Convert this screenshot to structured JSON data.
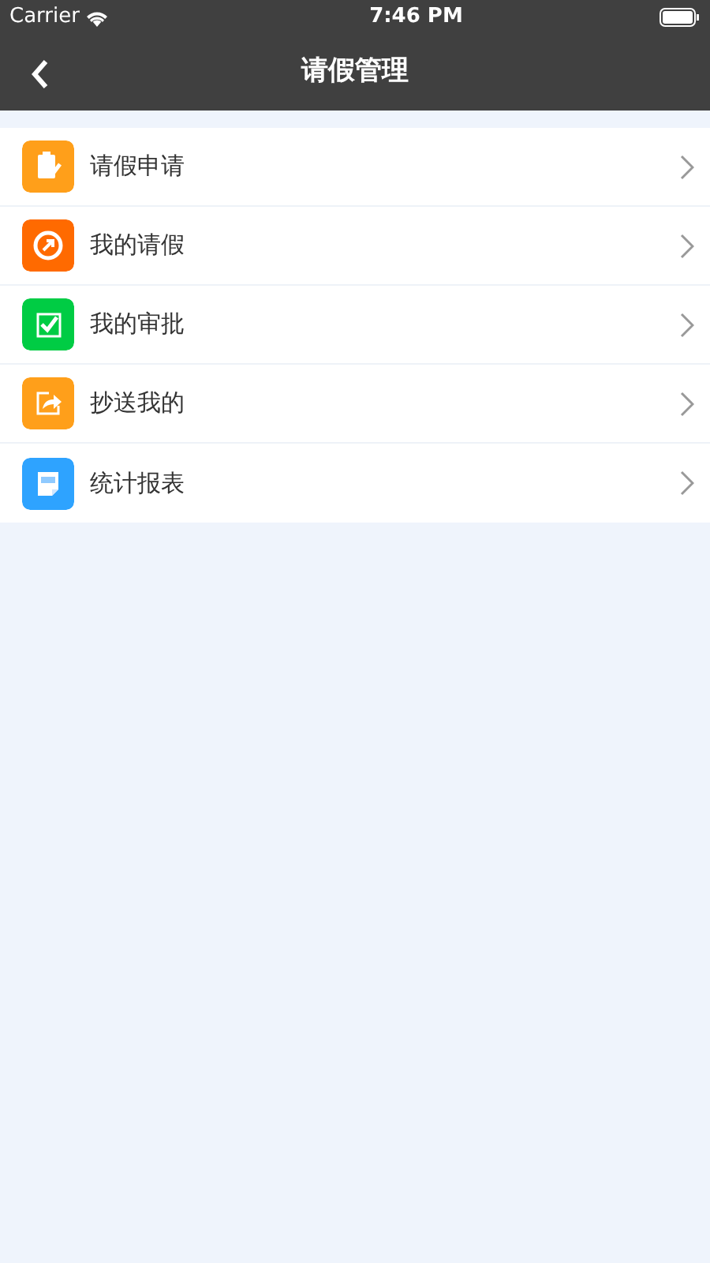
{
  "status_bar": {
    "carrier": "Carrier",
    "time": "7:46 PM"
  },
  "nav_bar": {
    "title": "请假管理"
  },
  "menu": [
    {
      "label": "请假申请",
      "kind": "clipboard",
      "color": "#ff9f1a"
    },
    {
      "label": "我的请假",
      "kind": "compass",
      "color": "#ff6a00"
    },
    {
      "label": "我的审批",
      "kind": "check",
      "color": "#00cc44"
    },
    {
      "label": "抄送我的",
      "kind": "share",
      "color": "#ff9f1a"
    },
    {
      "label": "统计报表",
      "kind": "report",
      "color": "#2ea3ff"
    }
  ]
}
